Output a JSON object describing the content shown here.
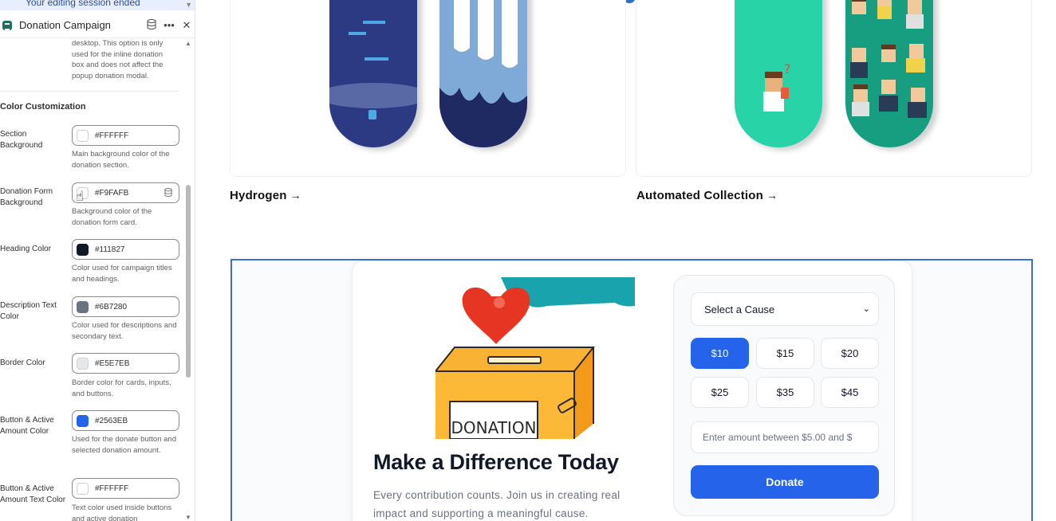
{
  "editor": {
    "session_banner": "Your editing session ended",
    "panel_title": "Donation Campaign",
    "header_icons": [
      "database-icon",
      "more-icon",
      "close-icon"
    ],
    "previous_help": "desktop. This option is only used for the inline donation box and does not affect the popup donation modal.",
    "section_heading": "Color Customization",
    "fields": [
      {
        "label": "Section Background",
        "value": "#FFFFFF",
        "swatch": "#FFFFFF",
        "help": "Main background color of the donation section."
      },
      {
        "label": "Donation Form Background",
        "value": "#F9FAFB",
        "swatch": "#F9FAFB",
        "help": "Background color of the donation form card."
      },
      {
        "label": "Heading Color",
        "value": "#111827",
        "swatch": "#111827",
        "help": "Color used for campaign titles and headings."
      },
      {
        "label": "Description Text Color",
        "value": "#6B7280",
        "swatch": "#6B7280",
        "help": "Color used for descriptions and secondary text."
      },
      {
        "label": "Border Color",
        "value": "#E5E7EB",
        "swatch": "#E5E7EB",
        "help": "Border color for cards, inputs, and buttons."
      },
      {
        "label": "Button & Active Amount Color",
        "value": "#2563EB",
        "swatch": "#2563EB",
        "help": "Used for the donate button and selected donation amount."
      },
      {
        "label": "Button & Active Amount Text Color",
        "value": "#FFFFFF",
        "swatch": "#FFFFFF",
        "help": "Text color used inside buttons and active donation"
      }
    ]
  },
  "preview": {
    "collections": [
      {
        "name": "Hydrogen",
        "arrow": "→"
      },
      {
        "name": "Automated Collection",
        "arrow": "→"
      }
    ],
    "donation": {
      "heading": "Make a Difference Today",
      "description": "Every contribution counts. Join us in creating real impact and supporting a meaningful cause.",
      "illustration_text": "DONATION",
      "cause_select": "Select a Cause",
      "amounts": [
        "$10",
        "$15",
        "$20",
        "$25",
        "$35",
        "$45"
      ],
      "active_amount": "$10",
      "custom_amount_placeholder": "Enter amount between $5.00 and $",
      "donate_label": "Donate",
      "accent_color": "#2563EB"
    }
  }
}
